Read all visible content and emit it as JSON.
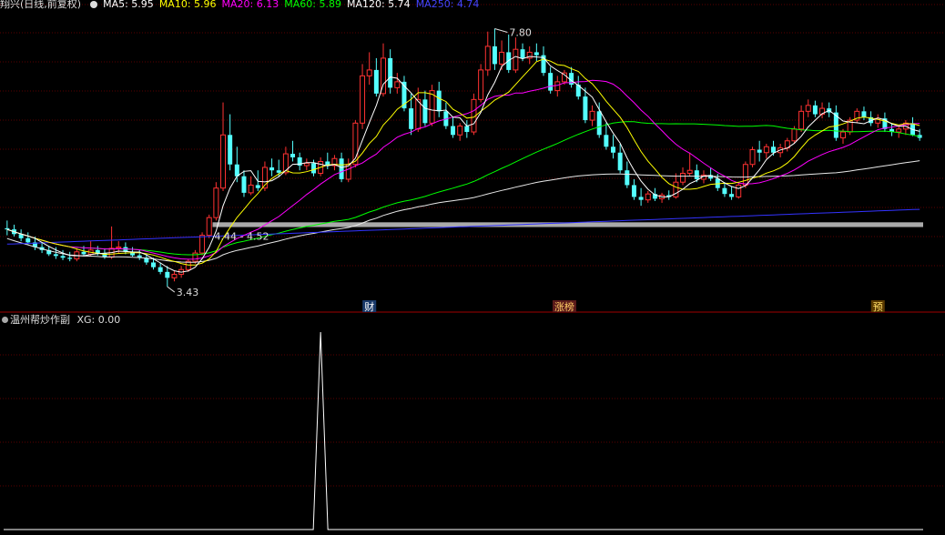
{
  "header": {
    "stock_title": "翔兴(日线,前复权)",
    "ma_items": [
      {
        "label": "MA5: 5.95",
        "color": "#ffffff"
      },
      {
        "label": "MA10: 5.96",
        "color": "#ffff00"
      },
      {
        "label": "MA20: 6.13",
        "color": "#ff00ff"
      },
      {
        "label": "MA60: 5.89",
        "color": "#00ff00"
      },
      {
        "label": "MA120: 5.74",
        "color": "#ffffff"
      },
      {
        "label": "MA250: 4.74",
        "color": "#4444ff"
      }
    ]
  },
  "colors": {
    "up": "#ff3232",
    "down": "#54ffff",
    "ma5": "#ffffff",
    "ma10": "#ffff00",
    "ma20": "#ff00ff",
    "ma60": "#00ff00",
    "ma120": "#e8e8e8",
    "ma250": "#3333ff",
    "grid": "#5a0000",
    "band": "#c8c8c8"
  },
  "annotations": {
    "high_label": "7.80",
    "low_label": "3.43",
    "range_label": "4.44 - 4.52"
  },
  "events": [
    {
      "label": "财",
      "bar": 52,
      "bg": "#1a3a6a",
      "fg": "#ffffff"
    },
    {
      "label": "涨榜",
      "bar": 80,
      "bg": "#5a1a1a",
      "fg": "#ffcc66"
    },
    {
      "label": "预",
      "bar": 125,
      "bg": "#5a3a00",
      "fg": "#ffdd66"
    }
  ],
  "sub_panel": {
    "title": "温州帮炒作副",
    "indicator": "XG: 0.00"
  },
  "chart_data": [
    {
      "type": "candlestick",
      "title": "翔兴(日线,前复权)",
      "ylim": [
        3.2,
        8.1
      ],
      "ohlc": [
        [
          4.42,
          4.55,
          4.3,
          4.4
        ],
        [
          4.4,
          4.48,
          4.28,
          4.32
        ],
        [
          4.32,
          4.4,
          4.2,
          4.25
        ],
        [
          4.25,
          4.35,
          4.15,
          4.18
        ],
        [
          4.18,
          4.28,
          4.05,
          4.1
        ],
        [
          4.1,
          4.18,
          4.0,
          4.05
        ],
        [
          4.05,
          4.12,
          3.95,
          3.98
        ],
        [
          3.98,
          4.1,
          3.9,
          3.95
        ],
        [
          3.95,
          4.05,
          3.88,
          3.92
        ],
        [
          3.92,
          4.02,
          3.86,
          3.9
        ],
        [
          3.9,
          4.08,
          3.86,
          4.02
        ],
        [
          4.02,
          4.12,
          3.95,
          3.98
        ],
        [
          3.98,
          4.2,
          3.94,
          4.05
        ],
        [
          4.05,
          4.12,
          3.96,
          4.0
        ],
        [
          4.0,
          4.08,
          3.9,
          3.93
        ],
        [
          3.93,
          4.45,
          3.9,
          4.08
        ],
        [
          4.08,
          4.2,
          4.0,
          4.1
        ],
        [
          4.1,
          4.18,
          3.98,
          4.02
        ],
        [
          4.02,
          4.1,
          3.94,
          3.96
        ],
        [
          3.96,
          4.05,
          3.88,
          3.92
        ],
        [
          3.92,
          3.98,
          3.8,
          3.84
        ],
        [
          3.84,
          3.92,
          3.72,
          3.76
        ],
        [
          3.76,
          3.84,
          3.64,
          3.68
        ],
        [
          3.68,
          3.78,
          3.43,
          3.58
        ],
        [
          3.58,
          3.7,
          3.52,
          3.64
        ],
        [
          3.64,
          3.78,
          3.58,
          3.72
        ],
        [
          3.72,
          3.9,
          3.68,
          3.86
        ],
        [
          3.86,
          4.05,
          3.82,
          4.0
        ],
        [
          4.0,
          4.35,
          3.96,
          4.3
        ],
        [
          4.3,
          4.65,
          4.25,
          4.6
        ],
        [
          4.6,
          5.2,
          4.55,
          5.1
        ],
        [
          5.1,
          6.55,
          5.05,
          6.0
        ],
        [
          6.0,
          6.35,
          5.4,
          5.5
        ],
        [
          5.5,
          5.8,
          5.2,
          5.3
        ],
        [
          5.3,
          5.4,
          4.95,
          5.02
        ],
        [
          5.02,
          5.3,
          4.98,
          5.15
        ],
        [
          5.15,
          5.4,
          5.05,
          5.1
        ],
        [
          5.1,
          5.55,
          5.05,
          5.45
        ],
        [
          5.45,
          5.6,
          5.3,
          5.4
        ],
        [
          5.4,
          5.58,
          5.3,
          5.36
        ],
        [
          5.36,
          5.8,
          5.32,
          5.68
        ],
        [
          5.68,
          5.9,
          5.55,
          5.62
        ],
        [
          5.62,
          5.7,
          5.4,
          5.48
        ],
        [
          5.48,
          5.6,
          5.4,
          5.52
        ],
        [
          5.52,
          5.58,
          5.3,
          5.35
        ],
        [
          5.35,
          5.62,
          5.3,
          5.55
        ],
        [
          5.55,
          5.7,
          5.42,
          5.48
        ],
        [
          5.48,
          5.66,
          5.4,
          5.6
        ],
        [
          5.6,
          5.7,
          5.2,
          5.25
        ],
        [
          5.25,
          5.6,
          5.2,
          5.5
        ],
        [
          5.5,
          6.25,
          5.45,
          6.2
        ],
        [
          6.2,
          7.2,
          6.1,
          7.0
        ],
        [
          7.0,
          7.4,
          6.85,
          7.1
        ],
        [
          7.1,
          7.3,
          6.65,
          6.7
        ],
        [
          6.7,
          7.55,
          6.65,
          7.3
        ],
        [
          7.3,
          7.45,
          6.7,
          6.8
        ],
        [
          6.8,
          7.05,
          6.7,
          6.9
        ],
        [
          6.9,
          7.0,
          6.4,
          6.45
        ],
        [
          6.45,
          6.7,
          6.0,
          6.1
        ],
        [
          6.1,
          6.8,
          6.05,
          6.6
        ],
        [
          6.6,
          6.75,
          6.15,
          6.2
        ],
        [
          6.2,
          6.85,
          6.15,
          6.75
        ],
        [
          6.75,
          6.9,
          6.3,
          6.4
        ],
        [
          6.4,
          6.55,
          6.1,
          6.15
        ],
        [
          6.15,
          6.3,
          5.95,
          6.0
        ],
        [
          6.0,
          6.2,
          5.9,
          6.15
        ],
        [
          6.15,
          6.25,
          5.95,
          6.05
        ],
        [
          6.05,
          6.7,
          6.0,
          6.6
        ],
        [
          6.6,
          7.2,
          6.55,
          7.1
        ],
        [
          7.1,
          7.75,
          7.0,
          7.5
        ],
        [
          7.5,
          7.8,
          7.1,
          7.2
        ],
        [
          7.2,
          7.6,
          7.1,
          7.4
        ],
        [
          7.4,
          7.7,
          7.05,
          7.1
        ],
        [
          7.1,
          7.65,
          7.05,
          7.45
        ],
        [
          7.45,
          7.55,
          7.25,
          7.3
        ],
        [
          7.3,
          7.5,
          7.2,
          7.4
        ],
        [
          7.4,
          7.55,
          7.25,
          7.35
        ],
        [
          7.35,
          7.5,
          7.0,
          7.05
        ],
        [
          7.05,
          7.15,
          6.7,
          6.75
        ],
        [
          6.75,
          7.0,
          6.65,
          6.9
        ],
        [
          6.9,
          7.1,
          6.85,
          7.05
        ],
        [
          7.05,
          7.15,
          6.8,
          6.85
        ],
        [
          6.85,
          7.0,
          6.6,
          6.65
        ],
        [
          6.65,
          6.8,
          6.2,
          6.25
        ],
        [
          6.25,
          6.5,
          6.15,
          6.4
        ],
        [
          6.4,
          6.55,
          5.95,
          6.0
        ],
        [
          6.0,
          6.2,
          5.75,
          5.8
        ],
        [
          5.8,
          6.0,
          5.6,
          5.7
        ],
        [
          5.7,
          5.85,
          5.35,
          5.4
        ],
        [
          5.4,
          5.55,
          5.1,
          5.15
        ],
        [
          5.15,
          5.25,
          4.9,
          4.95
        ],
        [
          4.95,
          5.1,
          4.8,
          4.9
        ],
        [
          4.9,
          5.05,
          4.85,
          5.0
        ],
        [
          5.0,
          5.1,
          4.88,
          4.92
        ],
        [
          4.92,
          5.02,
          4.85,
          4.98
        ],
        [
          4.98,
          5.06,
          4.9,
          4.95
        ],
        [
          4.95,
          5.35,
          4.92,
          5.2
        ],
        [
          5.2,
          5.45,
          5.15,
          5.35
        ],
        [
          5.35,
          5.7,
          5.3,
          5.4
        ],
        [
          5.4,
          5.5,
          5.2,
          5.25
        ],
        [
          5.25,
          5.4,
          5.18,
          5.32
        ],
        [
          5.32,
          5.45,
          5.22,
          5.26
        ],
        [
          5.26,
          5.34,
          5.05,
          5.1
        ],
        [
          5.1,
          5.2,
          4.95,
          5.0
        ],
        [
          5.0,
          5.12,
          4.9,
          4.95
        ],
        [
          4.95,
          5.2,
          4.92,
          5.15
        ],
        [
          5.15,
          5.55,
          5.1,
          5.5
        ],
        [
          5.5,
          5.8,
          5.45,
          5.75
        ],
        [
          5.75,
          5.9,
          5.55,
          5.7
        ],
        [
          5.7,
          5.85,
          5.6,
          5.8
        ],
        [
          5.8,
          5.9,
          5.65,
          5.7
        ],
        [
          5.7,
          5.85,
          5.62,
          5.78
        ],
        [
          5.78,
          5.95,
          5.72,
          5.9
        ],
        [
          5.9,
          6.15,
          5.85,
          6.1
        ],
        [
          6.1,
          6.5,
          6.05,
          6.4
        ],
        [
          6.4,
          6.6,
          6.3,
          6.5
        ],
        [
          6.5,
          6.58,
          6.3,
          6.35
        ],
        [
          6.35,
          6.55,
          6.28,
          6.45
        ],
        [
          6.45,
          6.55,
          6.3,
          6.38
        ],
        [
          6.38,
          6.5,
          5.9,
          5.95
        ],
        [
          5.95,
          6.1,
          5.85,
          6.05
        ],
        [
          6.05,
          6.3,
          6.0,
          6.25
        ],
        [
          6.25,
          6.45,
          6.2,
          6.4
        ],
        [
          6.4,
          6.48,
          6.25,
          6.3
        ],
        [
          6.3,
          6.4,
          6.15,
          6.2
        ],
        [
          6.2,
          6.35,
          6.12,
          6.28
        ],
        [
          6.28,
          6.38,
          6.05,
          6.1
        ],
        [
          6.1,
          6.2,
          5.98,
          6.05
        ],
        [
          6.05,
          6.15,
          5.95,
          6.1
        ],
        [
          6.1,
          6.25,
          6.0,
          6.2
        ],
        [
          6.2,
          6.3,
          5.98,
          6.0
        ],
        [
          6.0,
          6.1,
          5.9,
          5.95
        ]
      ],
      "band": [
        4.44,
        4.52
      ],
      "high": 7.8,
      "low": 3.43
    },
    {
      "type": "line",
      "name": "XG",
      "current_value": 0.0,
      "ylim": [
        0,
        1
      ],
      "spike_at_bar": 45,
      "spike_value": 1
    }
  ]
}
